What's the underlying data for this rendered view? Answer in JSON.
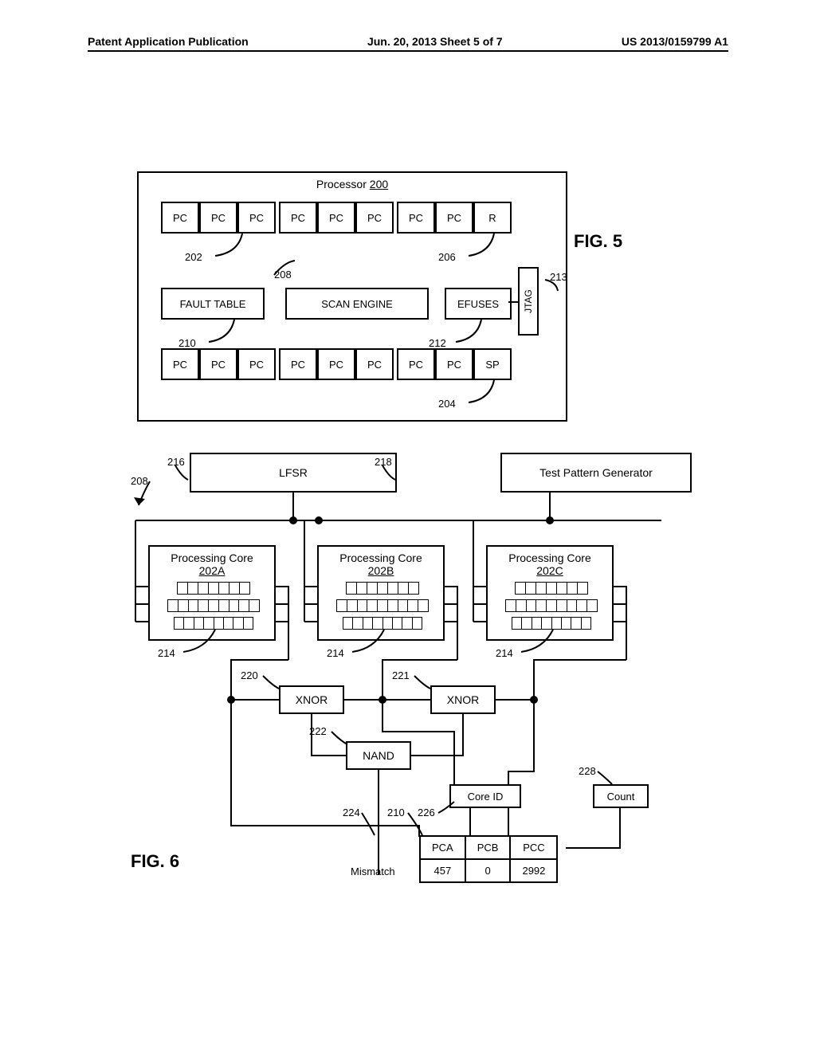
{
  "header": {
    "left": "Patent Application Publication",
    "mid": "Jun. 20, 2013  Sheet 5 of 7",
    "right": "US 2013/0159799 A1"
  },
  "fig5": {
    "label": "FIG. 5",
    "processor_label": "Processor",
    "processor_ref": "200",
    "top_row": [
      "PC",
      "PC",
      "PC",
      "PC",
      "PC",
      "PC",
      "PC",
      "PC",
      "R"
    ],
    "bot_row": [
      "PC",
      "PC",
      "PC",
      "PC",
      "PC",
      "PC",
      "PC",
      "PC",
      "SP"
    ],
    "fault_table": "FAULT TABLE",
    "scan_engine": "SCAN ENGINE",
    "efuses": "EFUSES",
    "jtag": "JTAG",
    "refs": {
      "r202": "202",
      "r206": "206",
      "r208": "208",
      "r210": "210",
      "r212": "212",
      "r204": "204",
      "r213": "213"
    }
  },
  "fig6": {
    "label": "FIG. 6",
    "lfsr": "LFSR",
    "tpg": "Test Pattern Generator",
    "core_label": "Processing Core",
    "coreA_ref": "202A",
    "coreB_ref": "202B",
    "coreC_ref": "202C",
    "xnor": "XNOR",
    "nand": "NAND",
    "coreid": "Core ID",
    "count": "Count",
    "mismatch": "Mismatch",
    "refs": {
      "r208": "208",
      "r216": "216",
      "r218": "218",
      "r214a": "214",
      "r214b": "214",
      "r214c": "214",
      "r220": "220",
      "r221": "221",
      "r222": "222",
      "r224": "224",
      "r210": "210",
      "r226": "226",
      "r228": "228"
    },
    "table": {
      "headers": [
        "PCA",
        "PCB",
        "PCC"
      ],
      "values": [
        "457",
        "0",
        "2992"
      ]
    }
  }
}
